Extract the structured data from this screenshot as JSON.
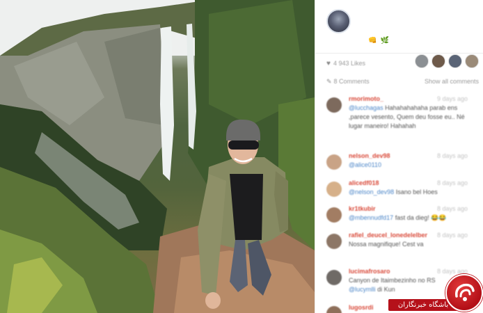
{
  "post": {
    "emojis": [
      "👊",
      "🌿"
    ],
    "likes_label": "4 943 Likes",
    "comments_label": "8 Comments",
    "show_all_label": "Show all comments"
  },
  "comments": [
    {
      "user": "rmorimoto_",
      "time": "9 days ago",
      "mention": "@lucchagas",
      "text": " Hahahahahaha parab ens ,parece vesento, Quem deu fosse eu.. Né lugar maneiro! Hahahah"
    },
    {
      "user": "nelson_dev98",
      "time": "8 days ago",
      "mention": "@alice0110",
      "text": ""
    },
    {
      "user": "alicedf018",
      "time": "8 days ago",
      "mention": "@nelson_dev98",
      "text": " Isano bel Hoes"
    },
    {
      "user": "kr1tkubir",
      "time": "8 days ago",
      "mention": "@mbennudfd17",
      "text": " fast da dieg! 😂😂"
    },
    {
      "user": "rafiel_deucel_lonedelelber",
      "time": "8 days ago",
      "mention": "",
      "text": "Nossa magnifique! Cest va"
    },
    {
      "user": "lucimafrosaro",
      "time": "8 days ago",
      "mention": "",
      "text": "Canyon de Itaimbezinho no RS",
      "mention2": "@lucymlli",
      "text2": " di Kun"
    },
    {
      "user": "lugosrdi",
      "time": "8 days ago",
      "mention": "",
      "text": ""
    }
  ],
  "watermark": {
    "label": "باشگاه خبرنگاران"
  }
}
